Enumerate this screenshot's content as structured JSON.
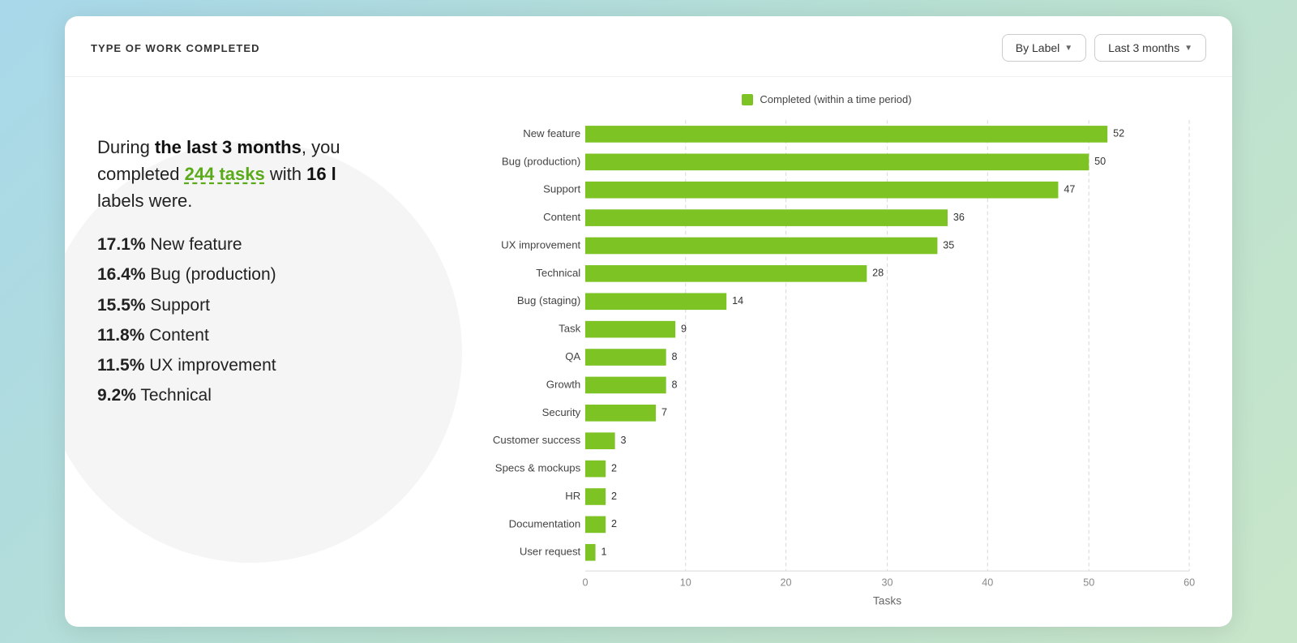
{
  "header": {
    "title": "TYPE OF WORK COMPLETED",
    "controls": {
      "by_label": "By Label",
      "last_3_months": "Last 3 months"
    }
  },
  "summary": {
    "period": "the last 3 months",
    "total_tasks": "244 tasks",
    "total_labels": "16 l",
    "suffix": "labels were."
  },
  "stats": [
    {
      "pct": "17.1%",
      "label": "New feature"
    },
    {
      "pct": "16.4%",
      "label": "Bug (production)"
    },
    {
      "pct": "15.5%",
      "label": "Support"
    },
    {
      "pct": "11.8%",
      "label": "Content"
    },
    {
      "pct": "11.5%",
      "label": "UX improvement"
    },
    {
      "pct": "9.2%",
      "label": "Technical"
    }
  ],
  "chart": {
    "legend": "Completed (within a time period)",
    "x_axis_label": "Tasks",
    "bars": [
      {
        "label": "New feature",
        "value": 52
      },
      {
        "label": "Bug (production)",
        "value": 50
      },
      {
        "label": "Support",
        "value": 47
      },
      {
        "label": "Content",
        "value": 36
      },
      {
        "label": "UX improvement",
        "value": 35
      },
      {
        "label": "Technical",
        "value": 28
      },
      {
        "label": "Bug (staging)",
        "value": 14
      },
      {
        "label": "Task",
        "value": 9
      },
      {
        "label": "QA",
        "value": 8
      },
      {
        "label": "Growth",
        "value": 8
      },
      {
        "label": "Security",
        "value": 7
      },
      {
        "label": "Customer success",
        "value": 3
      },
      {
        "label": "Specs & mockups",
        "value": 2
      },
      {
        "label": "HR",
        "value": 2
      },
      {
        "label": "Documentation",
        "value": 2
      },
      {
        "label": "User request",
        "value": 1
      }
    ],
    "x_ticks": [
      0,
      10,
      20,
      30,
      40,
      50,
      60
    ],
    "max_value": 60
  },
  "colors": {
    "bar_fill": "#7dc324",
    "background": "linear-gradient(135deg, #a8d8ea, #b8e0d2, #c8e6c9)",
    "accent_green": "#5aaa1a"
  }
}
